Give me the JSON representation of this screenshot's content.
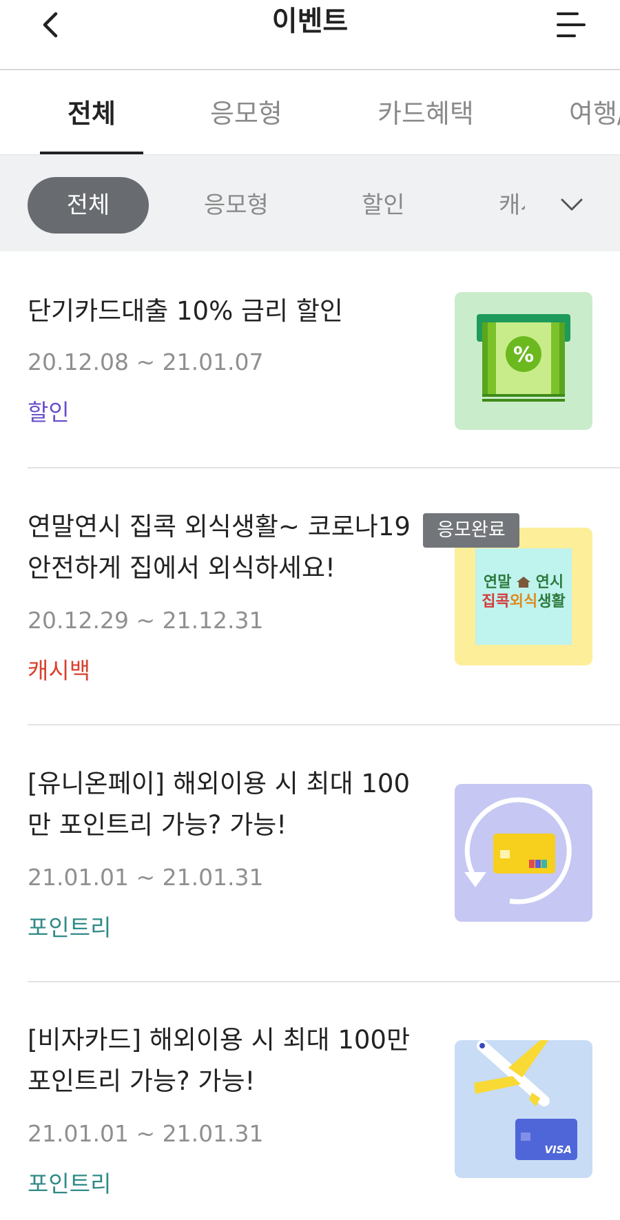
{
  "header": {
    "title": "이벤트",
    "back_icon": "chevron-left-icon",
    "menu_icon": "hamburger-menu-icon"
  },
  "tabs": [
    {
      "label": "전체",
      "active": true
    },
    {
      "label": "응모형",
      "active": false
    },
    {
      "label": "카드혜택",
      "active": false
    },
    {
      "label": "여행/",
      "active": false
    }
  ],
  "filters": {
    "chips": [
      {
        "label": "전체",
        "active": true
      },
      {
        "label": "응모형",
        "active": false
      },
      {
        "label": "할인",
        "active": false
      },
      {
        "label": "캐시",
        "active": false
      }
    ],
    "expand_icon": "chevron-down-icon"
  },
  "events": [
    {
      "title": "단기카드대출 10% 금리 할인",
      "period": "20.12.08 ~ 21.01.07",
      "category": "할인",
      "category_color": "#6b4fc8",
      "thumb_bg": "#c9eccb",
      "thumb_icon": "cash-percent-icon"
    },
    {
      "title": "연말연시 집콕 외식생활~ 코로나19 안전하게 집에서 외식하세요!",
      "period": "20.12.29 ~ 21.12.31",
      "category": "캐시백",
      "category_color": "#d9412f",
      "badge": "응모완료",
      "thumb_bg": "#fdee9a",
      "thumb_text_line1_a": "연말",
      "thumb_text_line1_b": "연시",
      "thumb_text_line2_a": "집콕",
      "thumb_text_line2_b": "외식",
      "thumb_text_line2_c": "생활"
    },
    {
      "title": "[유니온페이] 해외이용 시 최대 100만 포인트리 가능? 가능!",
      "period": "21.01.01 ~ 21.01.31",
      "category": "포인트리",
      "category_color": "#2f8a86",
      "thumb_bg": "#c6c7f3",
      "thumb_icon": "card-refresh-icon"
    },
    {
      "title": "[비자카드] 해외이용 시 최대 100만 포인트리 가능? 가능!",
      "period": "21.01.01 ~ 21.01.31",
      "category": "포인트리",
      "category_color": "#2f8a86",
      "thumb_bg": "#c8dcf5",
      "thumb_icon": "airplane-card-icon",
      "thumb_card_text": "VISA"
    }
  ]
}
